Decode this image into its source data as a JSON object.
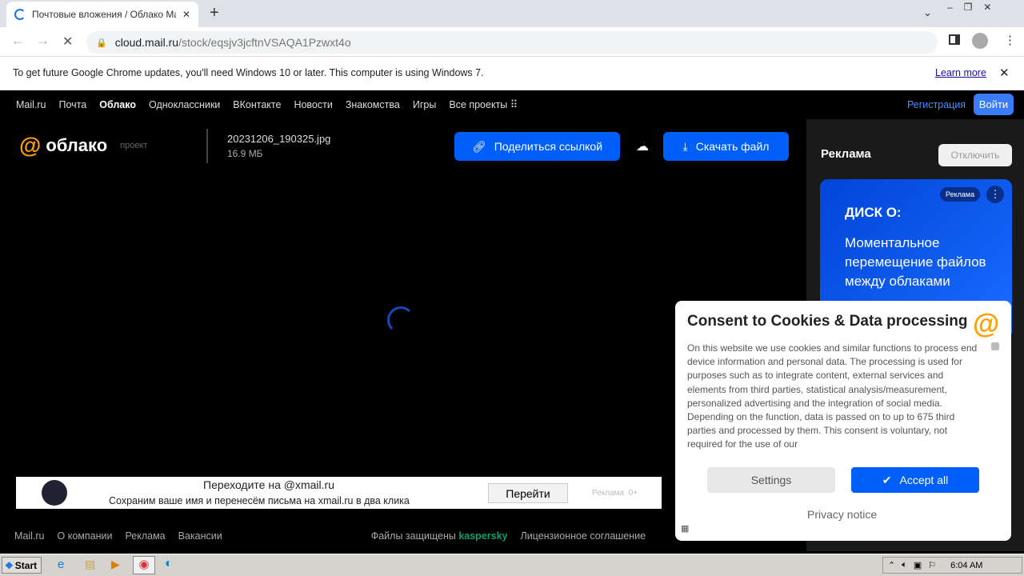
{
  "browser": {
    "tab_title": "Почтовые вложения / Облако Mail",
    "url_host": "cloud.mail.ru",
    "url_path": "/stock/eqsjv3jcftnVSAQA1Pzwxt4o"
  },
  "infobar": {
    "message": "To get future Google Chrome updates, you'll need Windows 10 or later. This computer is using Windows 7.",
    "learn_more": "Learn more"
  },
  "topnav": {
    "items": [
      "Mail.ru",
      "Почта",
      "Облако",
      "Одноклассники",
      "ВКонтакте",
      "Новости",
      "Знакомства",
      "Игры",
      "Все проекты"
    ],
    "register": "Регистрация",
    "login": "Войти"
  },
  "header": {
    "logo": "облако",
    "project": "проект",
    "file_name": "20231206_190325.jpg",
    "file_size": "16.9 МБ",
    "share": "Поделиться ссылкой",
    "download": "Скачать файл"
  },
  "sidebar": {
    "title": "Реклама",
    "disable": "Отключить",
    "ad_badge": "Реклама",
    "ad_brand": "ДИСК О:",
    "ad_text": "Моментальное перемещение файлов между облаками"
  },
  "banner": {
    "title": "Переходите на @xmail.ru",
    "text": "Сохраним ваше имя и перенесём письма на xmail.ru в два клика",
    "button": "Перейти",
    "label": "Реклама  0+"
  },
  "footer": {
    "links": [
      "Mail.ru",
      "О компании",
      "Реклама",
      "Вакансии"
    ],
    "protected": "Файлы защищены",
    "kaspersky": "kaspersky",
    "license": "Лицензионное соглашение"
  },
  "cookie": {
    "title": "Consent to Cookies & Data processing",
    "body": "On this website we use cookies and similar functions to process end device information and personal data. The processing is used for purposes such as to integrate content, external services and elements from third parties, statistical analysis/measurement, personalized advertising and the integration of social media. Depending on the function, data is passed on to up to 675 third parties and processed by them. This consent is voluntary, not required for the use of our",
    "settings": "Settings",
    "accept": "Accept all",
    "privacy": "Privacy notice"
  },
  "taskbar": {
    "start": "Start",
    "clock": "6:04 AM"
  },
  "colors": {
    "accent": "#005ff9",
    "brand_orange": "#ff9e00"
  }
}
